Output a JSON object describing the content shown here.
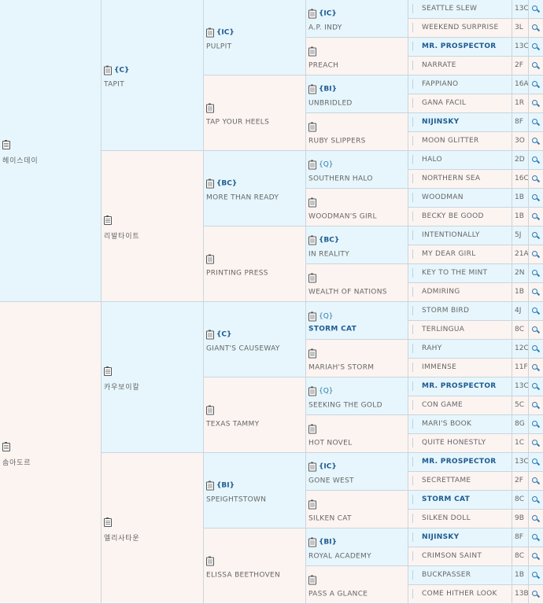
{
  "gen1": [
    {
      "name": "헤이스데이",
      "tag": "",
      "bold": false
    },
    {
      "name": "솜아도르",
      "tag": "",
      "bold": false
    }
  ],
  "gen2": [
    {
      "name": "TAPIT",
      "tag": "{C}",
      "bold": false
    },
    {
      "name": "리발타이트",
      "tag": "",
      "bold": false
    },
    {
      "name": "카우보이칼",
      "tag": "",
      "bold": false
    },
    {
      "name": "엘리사타운",
      "tag": "",
      "bold": false
    }
  ],
  "gen3": [
    {
      "name": "PULPIT",
      "tag": "{IC}",
      "bold": false
    },
    {
      "name": "TAP YOUR HEELS",
      "tag": "",
      "bold": false
    },
    {
      "name": "MORE THAN READY",
      "tag": "{BC}",
      "bold": false
    },
    {
      "name": "PRINTING PRESS",
      "tag": "",
      "bold": false
    },
    {
      "name": "GIANT'S CAUSEWAY",
      "tag": "{C}",
      "bold": false
    },
    {
      "name": "TEXAS TAMMY",
      "tag": "",
      "bold": false
    },
    {
      "name": "SPEIGHTSTOWN",
      "tag": "{BI}",
      "bold": false
    },
    {
      "name": "ELISSA BEETHOVEN",
      "tag": "",
      "bold": false
    }
  ],
  "gen4": [
    {
      "name": "A.P. INDY",
      "tag": "{IC}",
      "bold": false
    },
    {
      "name": "PREACH",
      "tag": "",
      "bold": false
    },
    {
      "name": "UNBRIDLED",
      "tag": "{BI}",
      "bold": false
    },
    {
      "name": "RUBY SLIPPERS",
      "tag": "",
      "bold": false
    },
    {
      "name": "SOUTHERN HALO",
      "tag": "{Q}",
      "bold": false
    },
    {
      "name": "WOODMAN'S GIRL",
      "tag": "",
      "bold": false
    },
    {
      "name": "IN REALITY",
      "tag": "{BC}",
      "bold": false
    },
    {
      "name": "WEALTH OF NATIONS",
      "tag": "",
      "bold": false
    },
    {
      "name": "STORM CAT",
      "tag": "{Q}",
      "bold": true
    },
    {
      "name": "MARIAH'S STORM",
      "tag": "",
      "bold": false
    },
    {
      "name": "SEEKING THE GOLD",
      "tag": "{Q}",
      "bold": false
    },
    {
      "name": "HOT NOVEL",
      "tag": "",
      "bold": false
    },
    {
      "name": "GONE WEST",
      "tag": "{IC}",
      "bold": false
    },
    {
      "name": "SILKEN CAT",
      "tag": "",
      "bold": false
    },
    {
      "name": "ROYAL ACADEMY",
      "tag": "{BI}",
      "bold": false
    },
    {
      "name": "PASS A GLANCE",
      "tag": "",
      "bold": false
    }
  ],
  "gen5": [
    {
      "name": "SEATTLE SLEW",
      "code": "13C",
      "bold": false
    },
    {
      "name": "WEEKEND SURPRISE",
      "code": "3L",
      "bold": false
    },
    {
      "name": "MR. PROSPECTOR",
      "code": "13C",
      "bold": true
    },
    {
      "name": "NARRATE",
      "code": "2F",
      "bold": false
    },
    {
      "name": "FAPPIANO",
      "code": "16A",
      "bold": false
    },
    {
      "name": "GANA FACIL",
      "code": "1R",
      "bold": false
    },
    {
      "name": "NIJINSKY",
      "code": "8F",
      "bold": true
    },
    {
      "name": "MOON GLITTER",
      "code": "3O",
      "bold": false
    },
    {
      "name": "HALO",
      "code": "2D",
      "bold": false
    },
    {
      "name": "NORTHERN SEA",
      "code": "16C",
      "bold": false
    },
    {
      "name": "WOODMAN",
      "code": "1B",
      "bold": false
    },
    {
      "name": "BECKY BE GOOD",
      "code": "1B",
      "bold": false
    },
    {
      "name": "INTENTIONALLY",
      "code": "5J",
      "bold": false
    },
    {
      "name": "MY DEAR GIRL",
      "code": "21A",
      "bold": false
    },
    {
      "name": "KEY TO THE MINT",
      "code": "2N",
      "bold": false
    },
    {
      "name": "ADMIRING",
      "code": "1B",
      "bold": false
    },
    {
      "name": "STORM BIRD",
      "code": "4J",
      "bold": false
    },
    {
      "name": "TERLINGUA",
      "code": "8C",
      "bold": false
    },
    {
      "name": "RAHY",
      "code": "12C",
      "bold": false
    },
    {
      "name": "IMMENSE",
      "code": "11F",
      "bold": false
    },
    {
      "name": "MR. PROSPECTOR",
      "code": "13C",
      "bold": true
    },
    {
      "name": "CON GAME",
      "code": "5C",
      "bold": false
    },
    {
      "name": "MARI'S BOOK",
      "code": "8G",
      "bold": false
    },
    {
      "name": "QUITE HONESTLY",
      "code": "1C",
      "bold": false
    },
    {
      "name": "MR. PROSPECTOR",
      "code": "13C",
      "bold": true
    },
    {
      "name": "SECRETTAME",
      "code": "2F",
      "bold": false
    },
    {
      "name": "STORM CAT",
      "code": "8C",
      "bold": true
    },
    {
      "name": "SILKEN DOLL",
      "code": "9B",
      "bold": false
    },
    {
      "name": "NIJINSKY",
      "code": "8F",
      "bold": true
    },
    {
      "name": "CRIMSON SAINT",
      "code": "8C",
      "bold": false
    },
    {
      "name": "BUCKPASSER",
      "code": "1B",
      "bold": false
    },
    {
      "name": "COME HITHER LOOK",
      "code": "13B",
      "bold": false
    }
  ]
}
